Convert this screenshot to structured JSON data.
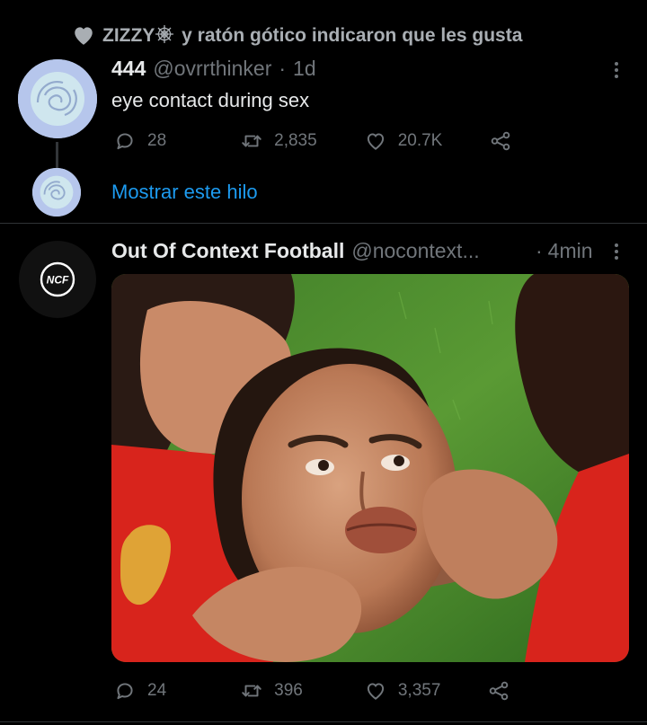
{
  "social_context": {
    "user": "ZIZZY",
    "text": "y ratón gótico indicaron que les gusta",
    "icon": "heart-icon"
  },
  "tweet1": {
    "display_name": "444",
    "handle": "@ovrrthinker",
    "separator": "·",
    "time": "1d",
    "text": "eye contact during sex",
    "replies": "28",
    "retweets": "2,835",
    "likes": "20.7K",
    "show_thread": "Mostrar este hilo"
  },
  "tweet2": {
    "display_name": "Out Of Context Football",
    "handle": "@nocontext...",
    "separator": "·",
    "time": "4min",
    "avatar_text": "NCF",
    "replies": "24",
    "retweets": "396",
    "likes": "3,357"
  },
  "colors": {
    "background": "#000000",
    "text": "#e7e9ea",
    "muted": "#71767b",
    "link": "#1d9bf0",
    "divider": "#2f3336"
  }
}
